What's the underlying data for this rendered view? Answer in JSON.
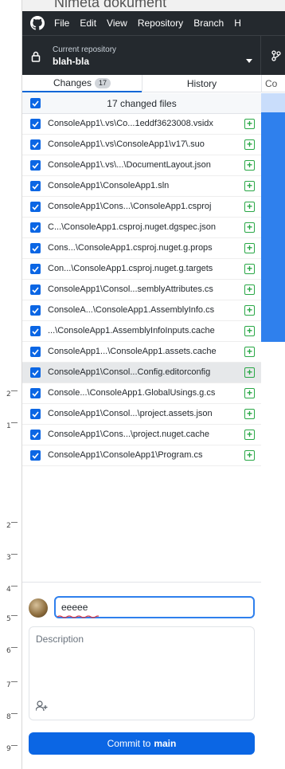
{
  "background": {
    "document_title": "Nimeta dokument"
  },
  "ruler": {
    "numbers": [
      "2",
      "1",
      "2",
      "3",
      "4",
      "5",
      "6",
      "7",
      "8",
      "9"
    ]
  },
  "menubar": {
    "logo_icon": "github-icon",
    "items": [
      "File",
      "Edit",
      "View",
      "Repository",
      "Branch",
      "H"
    ]
  },
  "repository": {
    "caption": "Current repository",
    "name": "blah-bla"
  },
  "tabs": {
    "changes_label": "Changes",
    "changes_count": "17",
    "history_label": "History",
    "extra_label": "Co"
  },
  "changes": {
    "summary": "17 changed files",
    "files": [
      "ConsoleApp1\\.vs\\Co...1eddf3623008.vsidx",
      "ConsoleApp1\\.vs\\ConsoleApp1\\v17\\.suo",
      "ConsoleApp1\\.vs\\...\\DocumentLayout.json",
      "ConsoleApp1\\ConsoleApp1.sln",
      "ConsoleApp1\\Cons...\\ConsoleApp1.csproj",
      "C...\\ConsoleApp1.csproj.nuget.dgspec.json",
      "Cons...\\ConsoleApp1.csproj.nuget.g.props",
      "Con...\\ConsoleApp1.csproj.nuget.g.targets",
      "ConsoleApp1\\Consol...semblyAttributes.cs",
      "ConsoleA...\\ConsoleApp1.AssemblyInfo.cs",
      "...\\ConsoleApp1.AssemblyInfoInputs.cache",
      "ConsoleApp1...\\ConsoleApp1.assets.cache",
      "ConsoleApp1\\Consol...Config.editorconfig",
      "Console...\\ConsoleApp1.GlobalUsings.g.cs",
      "ConsoleApp1\\Consol...\\project.assets.json",
      "ConsoleApp1\\Cons...\\project.nuget.cache",
      "ConsoleApp1\\ConsoleApp1\\Program.cs"
    ]
  },
  "commit": {
    "summary_value": "eeeee",
    "description_placeholder": "Description",
    "button_prefix": "Commit to",
    "branch": "main"
  },
  "colors": {
    "accent": "#0b66e4",
    "added": "#28a745",
    "titlebar": "#24292e"
  }
}
